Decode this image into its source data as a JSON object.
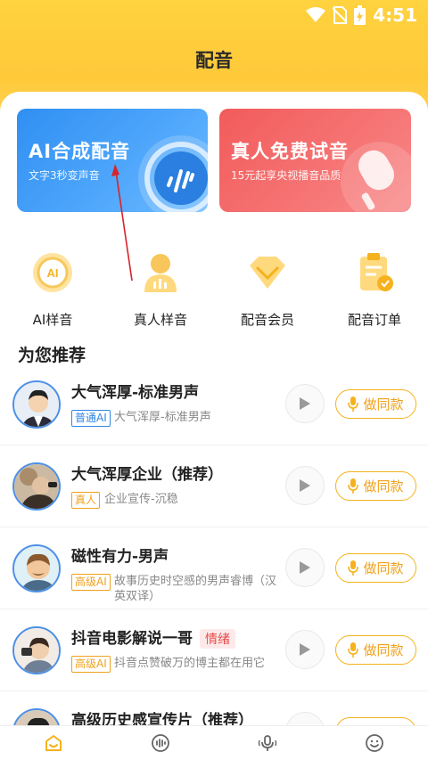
{
  "status": {
    "time": "4:51"
  },
  "header": {
    "title": "配音"
  },
  "banners": [
    {
      "title": "AI合成配音",
      "subtitle": "文字3秒变声音"
    },
    {
      "title": "真人免费试音",
      "subtitle": "15元起享央视播音品质"
    }
  ],
  "quick_actions": [
    {
      "label": "AI样音",
      "icon": "ai-bubble-icon"
    },
    {
      "label": "真人样音",
      "icon": "person-icon"
    },
    {
      "label": "配音会员",
      "icon": "diamond-icon"
    },
    {
      "label": "配音订单",
      "icon": "clipboard-icon"
    }
  ],
  "section": {
    "title": "为您推荐"
  },
  "voices": [
    {
      "name": "大气浑厚-标准男声",
      "tag": "普通AI",
      "tag_style": "blue",
      "desc": "大气浑厚-标准男声",
      "action": "做同款"
    },
    {
      "name": "大气浑厚企业（推荐）",
      "tag": "真人",
      "tag_style": "orange",
      "desc": "企业宣传-沉稳",
      "action": "做同款"
    },
    {
      "name": "磁性有力-男声",
      "tag": "高级AI",
      "tag_style": "orange",
      "desc": "故事历史时空感的男声睿博（汉英双译）",
      "action": "做同款"
    },
    {
      "name": "抖音电影解说一哥",
      "emotion": "情绪",
      "tag": "高级AI",
      "tag_style": "orange",
      "desc": "抖音点赞破万的博主都在用它",
      "action": "做同款"
    },
    {
      "name": "高级历史感宣传片（推荐）"
    }
  ],
  "tabbar": [
    {
      "icon": "home-icon",
      "active": true
    },
    {
      "icon": "waveform-icon"
    },
    {
      "icon": "microphone-icon"
    },
    {
      "icon": "smiley-icon"
    }
  ],
  "colors": {
    "accent": "#f5b21e",
    "header_yellow": "#ffc93a",
    "blue_banner": "#3b98f6",
    "red_banner": "#f46565"
  }
}
